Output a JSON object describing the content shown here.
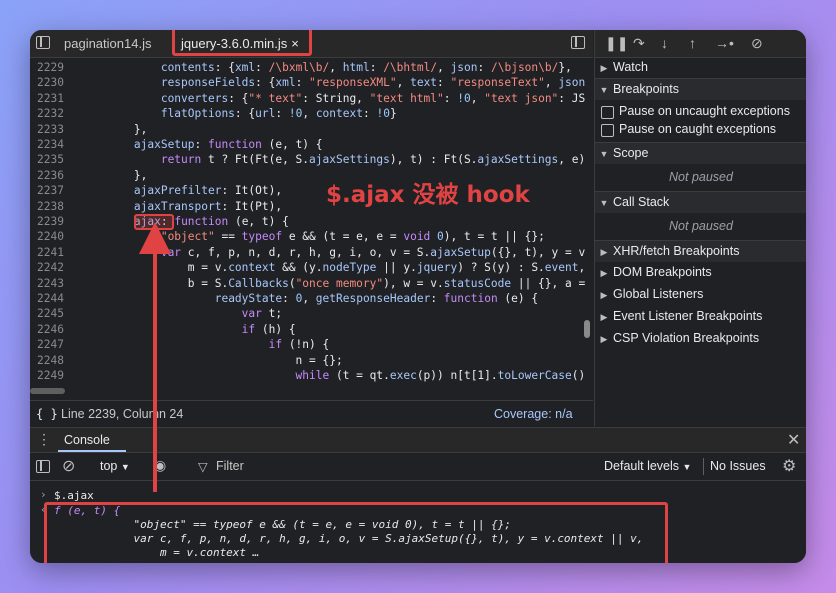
{
  "editor": {
    "tabs": [
      {
        "label": "pagination14.js"
      },
      {
        "label": "jquery-3.6.0.min.js",
        "close": "×"
      }
    ],
    "lines": [
      {
        "n": "2229",
        "parts": [
          [
            "",
            "            "
          ],
          [
            "prop",
            "contents"
          ],
          [
            "",
            ": {"
          ],
          [
            "prop",
            "xml"
          ],
          [
            "",
            ": "
          ],
          [
            "str",
            "/\\bxml\\b/"
          ],
          [
            "",
            ", "
          ],
          [
            "prop",
            "html"
          ],
          [
            "",
            ": "
          ],
          [
            "str",
            "/\\bhtml/"
          ],
          [
            "",
            ", "
          ],
          [
            "prop",
            "json"
          ],
          [
            "",
            ": "
          ],
          [
            "str",
            "/\\bjson\\b/"
          ],
          [
            "",
            "},"
          ]
        ]
      },
      {
        "n": "2230",
        "parts": [
          [
            "",
            "            "
          ],
          [
            "prop",
            "responseFields"
          ],
          [
            "",
            ": {"
          ],
          [
            "prop",
            "xml"
          ],
          [
            "",
            ": "
          ],
          [
            "str",
            "\"responseXML\""
          ],
          [
            "",
            ", "
          ],
          [
            "prop",
            "text"
          ],
          [
            "",
            ": "
          ],
          [
            "str",
            "\"responseText\""
          ],
          [
            "",
            ", "
          ],
          [
            "prop",
            "json"
          ]
        ]
      },
      {
        "n": "2231",
        "parts": [
          [
            "",
            "            "
          ],
          [
            "prop",
            "converters"
          ],
          [
            "",
            ": {"
          ],
          [
            "str",
            "\"* text\""
          ],
          [
            "",
            ": String, "
          ],
          [
            "str",
            "\"text html\""
          ],
          [
            "",
            ": "
          ],
          [
            "num",
            "!0"
          ],
          [
            "",
            ", "
          ],
          [
            "str",
            "\"text json\""
          ],
          [
            "",
            ": JS"
          ]
        ]
      },
      {
        "n": "2232",
        "parts": [
          [
            "",
            "            "
          ],
          [
            "prop",
            "flatOptions"
          ],
          [
            "",
            ": {"
          ],
          [
            "prop",
            "url"
          ],
          [
            "",
            ": "
          ],
          [
            "num",
            "!0"
          ],
          [
            "",
            ", "
          ],
          [
            "prop",
            "context"
          ],
          [
            "",
            ": "
          ],
          [
            "num",
            "!0"
          ],
          [
            "",
            "}"
          ]
        ]
      },
      {
        "n": "2233",
        "parts": [
          [
            "",
            "        },"
          ]
        ]
      },
      {
        "n": "2234",
        "parts": [
          [
            "",
            "        "
          ],
          [
            "prop",
            "ajaxSetup"
          ],
          [
            "",
            ": "
          ],
          [
            "kw",
            "function"
          ],
          [
            "",
            " (e, t) {"
          ]
        ]
      },
      {
        "n": "2235",
        "parts": [
          [
            "",
            "            "
          ],
          [
            "kw",
            "return"
          ],
          [
            "",
            " t ? Ft(Ft(e, S."
          ],
          [
            "prop",
            "ajaxSettings"
          ],
          [
            "",
            "), t) : Ft(S."
          ],
          [
            "prop",
            "ajaxSettings"
          ],
          [
            "",
            ", e)"
          ]
        ]
      },
      {
        "n": "2236",
        "parts": [
          [
            "",
            "        },"
          ]
        ]
      },
      {
        "n": "2237",
        "parts": [
          [
            "",
            "        "
          ],
          [
            "prop",
            "ajaxPrefilter"
          ],
          [
            "",
            ": It(Ot),"
          ]
        ]
      },
      {
        "n": "2238",
        "parts": [
          [
            "",
            "        "
          ],
          [
            "prop",
            "ajaxTransport"
          ],
          [
            "",
            ": It(Pt),"
          ]
        ]
      },
      {
        "n": "2239",
        "parts": [
          [
            "",
            "        "
          ],
          [
            "prop",
            "ajax"
          ],
          [
            "",
            ": "
          ],
          [
            "kw",
            "function"
          ],
          [
            "",
            " (e, t) {"
          ]
        ]
      },
      {
        "n": "2240",
        "parts": [
          [
            "",
            "            "
          ],
          [
            "str",
            "\"object\""
          ],
          [
            "",
            " == "
          ],
          [
            "kw",
            "typeof"
          ],
          [
            "",
            " e && (t = e, e = "
          ],
          [
            "kw",
            "void"
          ],
          [
            "",
            " "
          ],
          [
            "num",
            "0"
          ],
          [
            "",
            "), t = t || {};"
          ]
        ]
      },
      {
        "n": "2241",
        "parts": [
          [
            "",
            "            "
          ],
          [
            "kw",
            "var"
          ],
          [
            "",
            " c, f, p, n, d, r, h, g, i, o, v = S."
          ],
          [
            "prop",
            "ajaxSetup"
          ],
          [
            "",
            "({}, t), y = v"
          ]
        ]
      },
      {
        "n": "2242",
        "parts": [
          [
            "",
            "                m = v."
          ],
          [
            "prop",
            "context"
          ],
          [
            "",
            " && (y."
          ],
          [
            "prop",
            "nodeType"
          ],
          [
            "",
            " || y."
          ],
          [
            "prop",
            "jquery"
          ],
          [
            "",
            ") ? S(y) : S."
          ],
          [
            "prop",
            "event"
          ],
          [
            "",
            ","
          ]
        ]
      },
      {
        "n": "2243",
        "parts": [
          [
            "",
            "                b = S."
          ],
          [
            "prop",
            "Callbacks"
          ],
          [
            "",
            "("
          ],
          [
            "str",
            "\"once memory\""
          ],
          [
            "",
            "), w = v."
          ],
          [
            "prop",
            "statusCode"
          ],
          [
            "",
            " || {}, a ="
          ]
        ]
      },
      {
        "n": "2244",
        "parts": [
          [
            "",
            "                    "
          ],
          [
            "prop",
            "readyState"
          ],
          [
            "",
            ": "
          ],
          [
            "num",
            "0"
          ],
          [
            "",
            ", "
          ],
          [
            "prop",
            "getResponseHeader"
          ],
          [
            "",
            ": "
          ],
          [
            "kw",
            "function"
          ],
          [
            "",
            " (e) {"
          ]
        ]
      },
      {
        "n": "2245",
        "parts": [
          [
            "",
            "                        "
          ],
          [
            "kw",
            "var"
          ],
          [
            "",
            " t;"
          ]
        ]
      },
      {
        "n": "2246",
        "parts": [
          [
            "",
            "                        "
          ],
          [
            "kw",
            "if"
          ],
          [
            "",
            " (h) {"
          ]
        ]
      },
      {
        "n": "2247",
        "parts": [
          [
            "",
            "                            "
          ],
          [
            "kw",
            "if"
          ],
          [
            "",
            " (!n) {"
          ]
        ]
      },
      {
        "n": "2248",
        "parts": [
          [
            "",
            "                                n = {};"
          ]
        ]
      },
      {
        "n": "2249",
        "parts": [
          [
            "",
            "                                "
          ],
          [
            "kw",
            "while"
          ],
          [
            "",
            " (t = qt."
          ],
          [
            "prop",
            "exec"
          ],
          [
            "",
            "(p)) n[t[1]."
          ],
          [
            "prop",
            "toLowerCase"
          ],
          [
            "",
            "()"
          ]
        ]
      }
    ],
    "status": {
      "position": "Line 2239, Column 24",
      "coverage": "Coverage: n/a",
      "braces": "{ }"
    }
  },
  "annotation": "$.ajax 没被 hook",
  "debugger": {
    "sections": {
      "watch": "Watch",
      "breakpoints": "Breakpoints",
      "pause_uncaught": "Pause on uncaught exceptions",
      "pause_caught": "Pause on caught exceptions",
      "scope": "Scope",
      "scope_state": "Not paused",
      "call_stack": "Call Stack",
      "call_stack_state": "Not paused",
      "xhr": "XHR/fetch Breakpoints",
      "dom": "DOM Breakpoints",
      "global": "Global Listeners",
      "event": "Event Listener Breakpoints",
      "csp": "CSP Violation Breakpoints"
    }
  },
  "console": {
    "tab": "Console",
    "context": "top",
    "filter_placeholder": "Filter",
    "levels": "Default levels",
    "issues": "No Issues",
    "input": "$.ajax",
    "output": [
      "f (e, t) {",
      "            \"object\" == typeof e && (t = e, e = void 0), t = t || {};",
      "            var c, f, p, n, d, r, h, g, i, o, v = S.ajaxSetup({}, t), y = v.context || v,",
      "                m = v.context …"
    ]
  },
  "colors": {
    "highlight": "#e04343",
    "background": "#202124"
  }
}
